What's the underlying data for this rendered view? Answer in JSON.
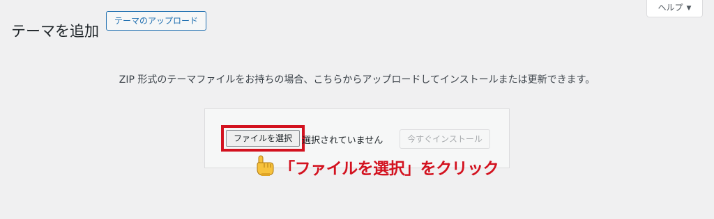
{
  "header": {
    "title": "テーマを追加",
    "upload_button_label": "テーマのアップロード"
  },
  "help_tab": {
    "label": "ヘルプ",
    "caret": "▼"
  },
  "upload": {
    "description": "ZIP 形式のテーマファイルをお持ちの場合、こちらからアップロードしてインストールまたは更新できます。",
    "choose_file_label": "ファイルを選択",
    "file_status": "選択されていません",
    "install_button_label": "今すぐインストール"
  },
  "annotation": {
    "text": "「ファイルを選択」をクリック",
    "icon": "pointing-hand-icon",
    "color": "#d3121f"
  },
  "colors": {
    "background": "#f0f0f1",
    "accent": "#2271b1",
    "highlight": "#d3121f"
  }
}
